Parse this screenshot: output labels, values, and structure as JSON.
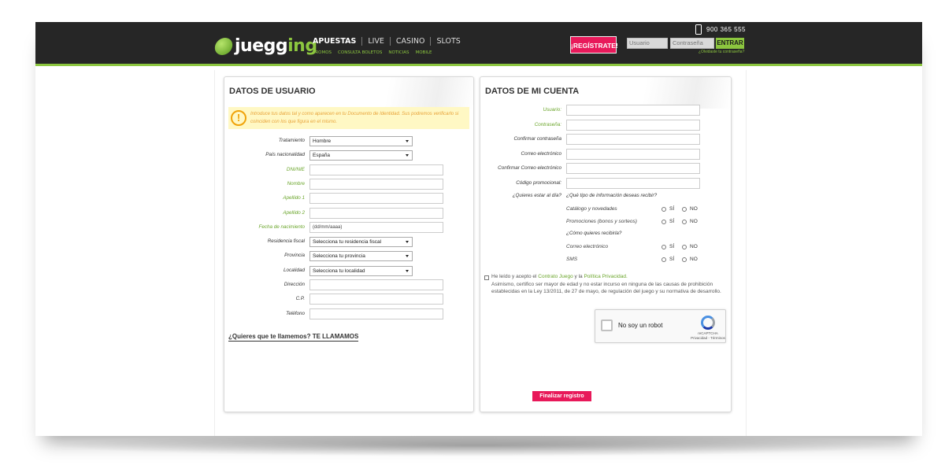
{
  "header": {
    "phone": "900 365 555",
    "brand_prefix": "juegg",
    "brand_suffix": "ing",
    "nav": [
      "APUESTAS",
      "LIVE",
      "CASINO",
      "SLOTS"
    ],
    "subnav": [
      "PROMOS",
      "CONSULTA BOLETOS",
      "NOTICIAS",
      "MOBILE"
    ],
    "register_label": "¡REGÍSTRATE!",
    "username_placeholder": "Usuario",
    "password_placeholder": "Contraseña",
    "login_label": "ENTRAR",
    "forgot_label": "¿Olvidaste tu contraseña?"
  },
  "user_panel": {
    "title": "DATOS DE USUARIO",
    "notice": "Introduce tus datos tal y como aparecen en tu Documento de Identidad. Sus podremos verificarlo si coinciden con los que figura en el mismo.",
    "fields": [
      {
        "label": "Tratamiento",
        "type": "select",
        "value": "Hombre",
        "green": false
      },
      {
        "label": "País nacionalidad",
        "type": "select",
        "value": "España",
        "green": false
      },
      {
        "label": "DNI/NIE",
        "type": "input",
        "value": "",
        "green": true
      },
      {
        "label": "Nombre",
        "type": "input",
        "value": "",
        "green": true
      },
      {
        "label": "Apellido 1",
        "type": "input",
        "value": "",
        "green": true
      },
      {
        "label": "Apellido 2",
        "type": "input",
        "value": "",
        "green": true
      },
      {
        "label": "Fecha de nacimiento",
        "type": "input",
        "value": "(dd/mm/aaaa)",
        "green": true
      },
      {
        "label": "Residencia fiscal",
        "type": "select",
        "value": "Selecciona tu residencia fiscal",
        "green": false
      },
      {
        "label": "Provincia",
        "type": "select",
        "value": "Selecciona tu provincia",
        "green": false
      },
      {
        "label": "Localidad",
        "type": "select",
        "value": "Selecciona tu localidad",
        "green": false
      },
      {
        "label": "Dirección",
        "type": "input",
        "value": "",
        "green": false
      },
      {
        "label": "C.P.",
        "type": "input",
        "value": "",
        "green": false
      },
      {
        "label": "Teléfono",
        "type": "input",
        "value": "",
        "green": false
      }
    ],
    "callme": "¿Quieres que te llamemos? TE LLAMAMOS"
  },
  "account_panel": {
    "title": "DATOS DE MI CUENTA",
    "fields": [
      {
        "label": "Usuario:",
        "green": true
      },
      {
        "label": "Contraseña:",
        "green": true
      },
      {
        "label": "Confirmar contraseña",
        "green": false
      },
      {
        "label": "Correo electrónico",
        "green": false
      },
      {
        "label": "Confirmar Correo electrónico",
        "green": false
      },
      {
        "label": "Código promocional:",
        "green": false
      }
    ],
    "pref_question": "¿Quieres estar al día?",
    "pref_info_question": "¿Qué tipo de información deseas recibir?",
    "pref_how_question": "¿Cómo quieres recibirla?",
    "options": [
      {
        "label": "Catálogo y novedades"
      },
      {
        "label": "Promociones (bonos y sorteos)"
      },
      {
        "label": "Correo electrónico"
      },
      {
        "label": "SMS"
      }
    ],
    "yes_label": "SÍ",
    "no_label": "NO",
    "legal_prefix": "He leído y acepto el",
    "legal_contract": "Contrato Juego",
    "legal_and": "y la",
    "legal_privacy": "Política Privacidad.",
    "legal_body": "Asimismo, certifico ser mayor de edad y no estar incurso en ninguna de las causas de prohibición establecidas en la Ley 13/2011, de 27 de mayo, de regulación del juego y su normativa de desarrollo.",
    "captcha_label": "No soy un robot",
    "captcha_brand": "reCAPTCHA",
    "captcha_links": "Privacidad - Términos"
  },
  "finalize_label": "Finalizar registro"
}
